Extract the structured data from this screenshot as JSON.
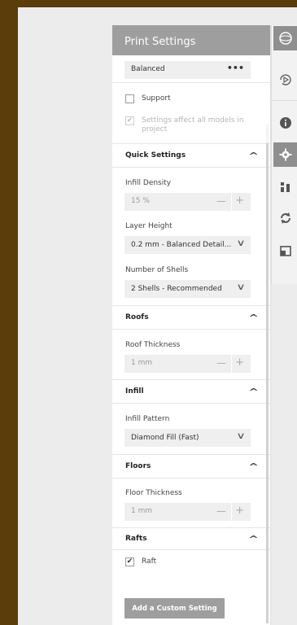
{
  "panel": {
    "title": "Print Settings",
    "preset": "Balanced",
    "preset_menu": "•••",
    "support_label": "Support",
    "affect_all_line1": "Settings affect all models in",
    "affect_all_line2": "project",
    "add_setting_label": "Add a Custom Setting"
  },
  "quick": {
    "title": "Quick Settings",
    "infill_density_label": "Infill Density",
    "infill_density_value": "15 %",
    "layer_height_label": "Layer Height",
    "layer_height_value": "0.2 mm - Balanced Detail...",
    "shells_label": "Number of Shells",
    "shells_value": "2 Shells - Recommended"
  },
  "roofs": {
    "title": "Roofs",
    "thickness_label": "Roof Thickness",
    "thickness_value": "1 mm"
  },
  "infill": {
    "title": "Infill",
    "pattern_label": "Infill Pattern",
    "pattern_value": "Diamond Fill (Fast)"
  },
  "floors": {
    "title": "Floors",
    "thickness_label": "Floor Thickness",
    "thickness_value": "1 mm"
  },
  "rafts": {
    "title": "Rafts",
    "raft_label": "Raft"
  },
  "stepper": {
    "minus": "—",
    "plus": "+"
  },
  "checkmark": "✔",
  "chevron_up": "^",
  "chevron_down": "∨",
  "toolbar": {
    "icons": [
      "globe-icon",
      "clock-play-icon",
      "info-icon",
      "gear-icon",
      "layers-icon",
      "rotate-icon",
      "scale-icon"
    ]
  }
}
